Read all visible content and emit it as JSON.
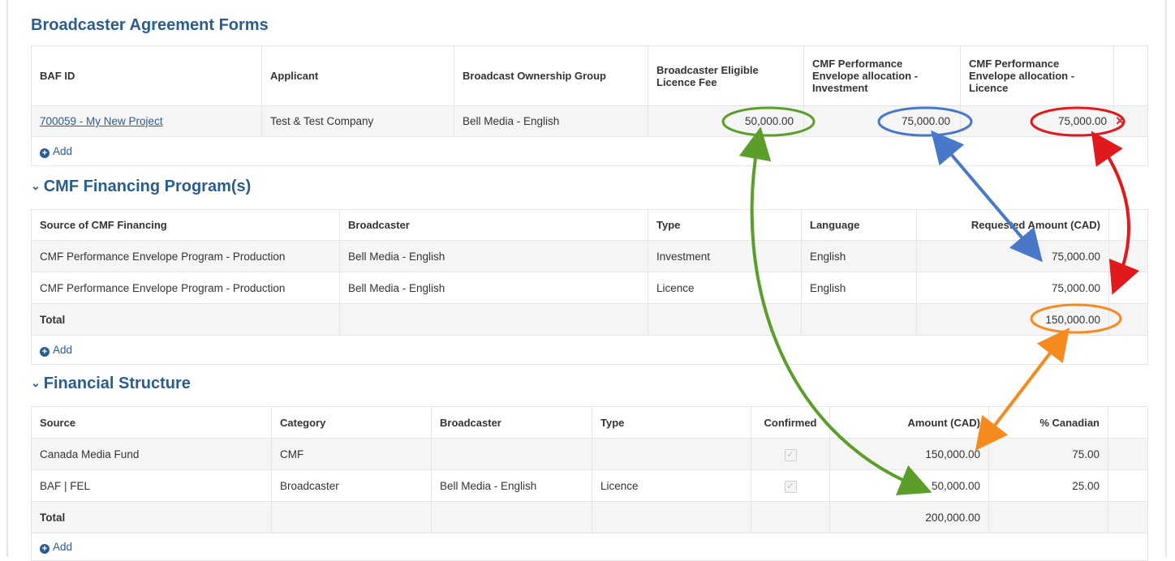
{
  "baf": {
    "title": "Broadcaster Agreement Forms",
    "headers": [
      "BAF ID",
      "Applicant",
      "Broadcast Ownership Group",
      "Broadcaster Eligible Licence Fee",
      "CMF Performance Envelope allocation - Investment",
      "CMF Performance Envelope allocation - Licence"
    ],
    "row": {
      "id": "700059 - My New Project",
      "applicant": "Test & Test Company",
      "group": "Bell Media - English",
      "fee": "50,000.00",
      "investment": "75,000.00",
      "licence": "75,000.00"
    },
    "add_label": "Add"
  },
  "cmf": {
    "title": "CMF Financing Program(s)",
    "headers": [
      "Source of CMF Financing",
      "Broadcaster",
      "Type",
      "Language",
      "Requested Amount (CAD)"
    ],
    "rows": [
      {
        "source": "CMF Performance Envelope Program - Production",
        "broadcaster": "Bell Media - English",
        "type": "Investment",
        "language": "English",
        "amount": "75,000.00"
      },
      {
        "source": "CMF Performance Envelope Program - Production",
        "broadcaster": "Bell Media - English",
        "type": "Licence",
        "language": "English",
        "amount": "75,000.00"
      }
    ],
    "total_label": "Total",
    "total_amount": "150,000.00",
    "add_label": "Add"
  },
  "fs": {
    "title": "Financial Structure",
    "headers": [
      "Source",
      "Category",
      "Broadcaster",
      "Type",
      "Confirmed",
      "Amount (CAD)",
      "% Canadian"
    ],
    "rows": [
      {
        "source": "Canada Media Fund",
        "category": "CMF",
        "broadcaster": "",
        "type": "",
        "amount": "150,000.00",
        "pct": "75.00"
      },
      {
        "source": "BAF | FEL",
        "category": "Broadcaster",
        "broadcaster": "Bell Media - English",
        "type": "Licence",
        "amount": "50,000.00",
        "pct": "25.00"
      }
    ],
    "total_label": "Total",
    "total_amount": "200,000.00",
    "add_label": "Add"
  },
  "colors": {
    "link": "#2a5d8f",
    "green": "#5b9e2b",
    "blue": "#4a78c8",
    "red": "#e0191d",
    "orange": "#f58a1f"
  },
  "icons": {
    "chevron": "chevron-down-icon",
    "add": "plus-circle-icon",
    "delete": "close-icon",
    "checkbox": "check-icon"
  }
}
